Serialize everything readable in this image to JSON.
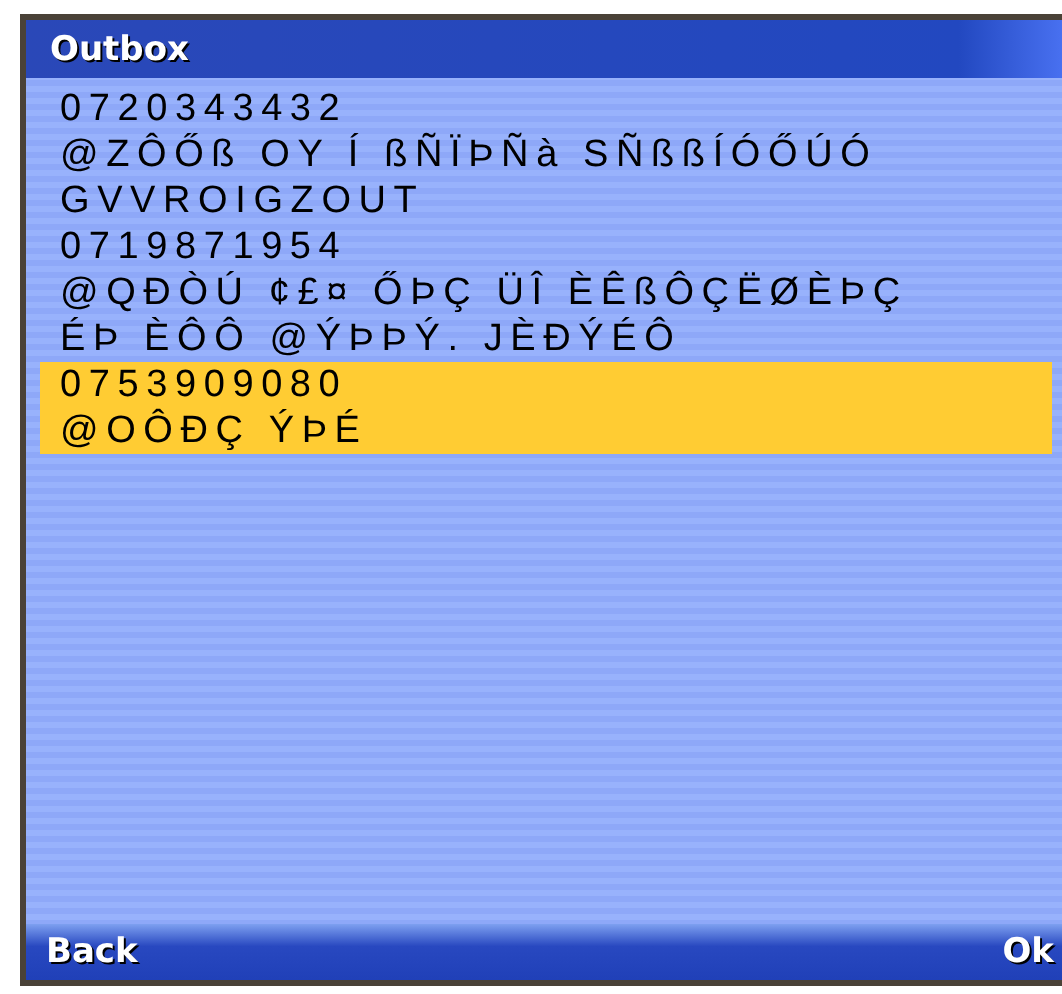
{
  "window": {
    "title": "Outbox"
  },
  "messages": [
    {
      "number": "0720343432",
      "lines": [
        "@ZÔŐß OY Í ßÑÏÞÑà SÑßßÍÓŐÚÓ",
        "GVVROIGZOUT"
      ],
      "selected": false
    },
    {
      "number": "0719871954",
      "lines": [
        "@QĐÒÚ ¢£¤ ŐÞÇ ÜÎ ÈÊßÔÇËØÈÞÇ",
        "ÉÞ ÈÔÔ @ÝÞÞÝ. JÈĐÝÉÔ"
      ],
      "selected": false
    },
    {
      "number": "0753909080",
      "lines": [
        "@OÔĐÇ ÝÞÉ"
      ],
      "selected": true
    }
  ],
  "softkeys": {
    "left": "Back",
    "right": "Ok"
  }
}
